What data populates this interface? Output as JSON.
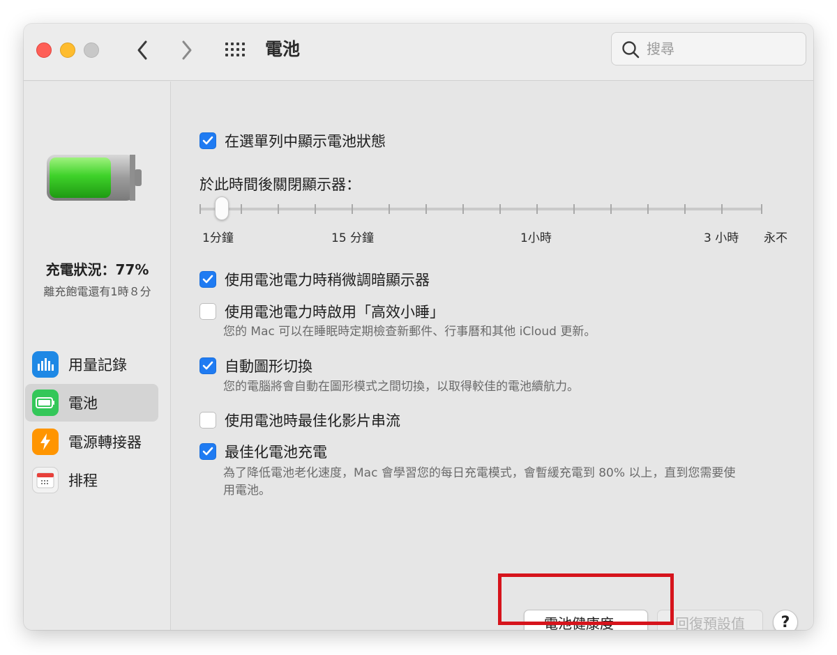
{
  "window": {
    "title": "電池",
    "search_placeholder": "搜尋"
  },
  "icons": {
    "back": "chevron-left-icon",
    "forward": "chevron-right-icon",
    "grid": "grid-icon",
    "search": "search-icon"
  },
  "sidebar": {
    "charge_status": "充電狀況：77%",
    "charge_level_fraction": 0.77,
    "time_remaining": "離充飽電還有1時８分",
    "items": [
      {
        "label": "用量記錄",
        "icon": "bar-chart-icon",
        "color": "#1e88e5"
      },
      {
        "label": "電池",
        "icon": "battery-icon",
        "color": "#34c759",
        "selected": true
      },
      {
        "label": "電源轉接器",
        "icon": "lightning-icon",
        "color": "#ff9500"
      },
      {
        "label": "排程",
        "icon": "calendar-icon",
        "color": "#e8e8e8"
      }
    ]
  },
  "settings": {
    "show_in_menu": {
      "label": "在選單列中顯示電池狀態",
      "checked": true
    },
    "display_off": {
      "title": "於此時間後關閉顯示器：",
      "tick_labels": [
        "1分鐘",
        "15 分鐘",
        "1小時",
        "3 小時",
        "永不"
      ],
      "value": "1分鐘"
    },
    "dim_display": {
      "label": "使用電池電力時稍微調暗顯示器",
      "checked": true
    },
    "power_nap": {
      "label": "使用電池電力時啟用「高效小睡」",
      "checked": false,
      "description": "您的 Mac 可以在睡眠時定期檢查新郵件、行事曆和其他 iCloud 更新。"
    },
    "auto_graphics": {
      "label": "自動圖形切換",
      "checked": true,
      "description": "您的電腦將會自動在圖形模式之間切換，以取得較佳的電池續航力。"
    },
    "video_streaming": {
      "label": "使用電池時最佳化影片串流",
      "checked": false
    },
    "optimized_charging": {
      "label": "最佳化電池充電",
      "checked": true,
      "description_line1": "為了降低電池老化速度，Mac 會學習您的每日充電模式，會暫緩充電到 80% 以上，直到您需要使",
      "description_line2": "用電池。"
    }
  },
  "footer": {
    "battery_health_label": "電池健康度⋯",
    "restore_defaults_label": "回復預設值",
    "help_label": "?"
  },
  "colors": {
    "accent": "#1f7bf2",
    "highlight_box": "#d6141c",
    "battery_fill": "#3fd22a"
  }
}
